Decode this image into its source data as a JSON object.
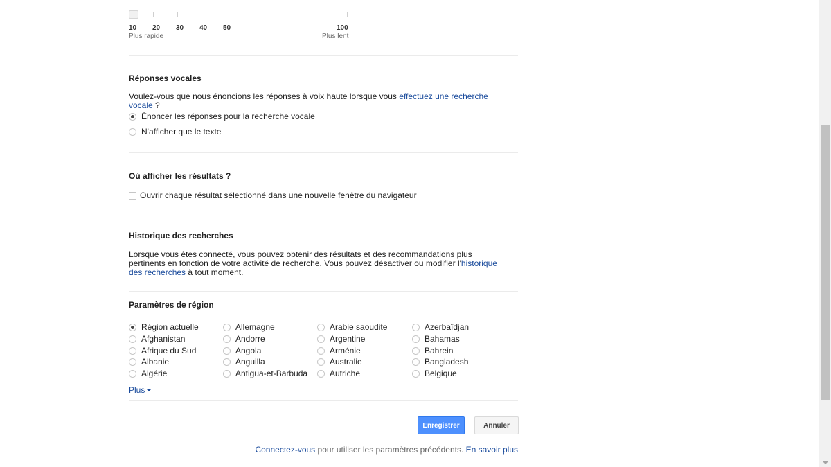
{
  "slider": {
    "ticks": [
      "10",
      "20",
      "30",
      "40",
      "50",
      "100"
    ],
    "fast_label": "Plus rapide",
    "slow_label": "Plus lent",
    "value": "10"
  },
  "voice": {
    "title": "Réponses vocales",
    "question_prefix": "Voulez-vous que nous énoncions les réponses à voix haute lorsque vous ",
    "question_link": "effectuez une recherche vocale",
    "question_suffix": " ?",
    "options": [
      {
        "label": "Énoncer les réponses pour la recherche vocale",
        "checked": true
      },
      {
        "label": "N'afficher que le texte",
        "checked": false
      }
    ]
  },
  "results": {
    "title": "Où afficher les résultats ?",
    "checkbox_label": "Ouvrir chaque résultat sélectionné dans une nouvelle fenêtre du navigateur",
    "checked": false
  },
  "history": {
    "title": "Historique des recherches",
    "text_prefix": "Lorsque vous êtes connecté, vous pouvez obtenir des résultats et des recommandations plus pertinents en fonction de votre activité de recherche. Vous pouvez désactiver ou modifier l'",
    "link": "historique des recherches",
    "text_suffix": " à tout moment."
  },
  "region": {
    "title": "Paramètres de région",
    "columns": [
      [
        "Région actuelle",
        "Afghanistan",
        "Afrique du Sud",
        "Albanie",
        "Algérie"
      ],
      [
        "Allemagne",
        "Andorre",
        "Angola",
        "Anguilla",
        "Antigua-et-Barbuda"
      ],
      [
        "Arabie saoudite",
        "Argentine",
        "Arménie",
        "Australie",
        "Autriche"
      ],
      [
        "Azerbaïdjan",
        "Bahamas",
        "Bahrein",
        "Bangladesh",
        "Belgique"
      ]
    ],
    "selected": "Région actuelle",
    "more_label": "Plus",
    "more_icon": "caret-down-icon"
  },
  "buttons": {
    "save": "Enregistrer",
    "cancel": "Annuler"
  },
  "footer": {
    "signin_link": "Connectez-vous",
    "text": " pour utiliser les paramètres précédents. ",
    "learn_more": "En savoir plus"
  },
  "colors": {
    "link": "#1a4b9c",
    "primary_button": "#4d90fe"
  }
}
